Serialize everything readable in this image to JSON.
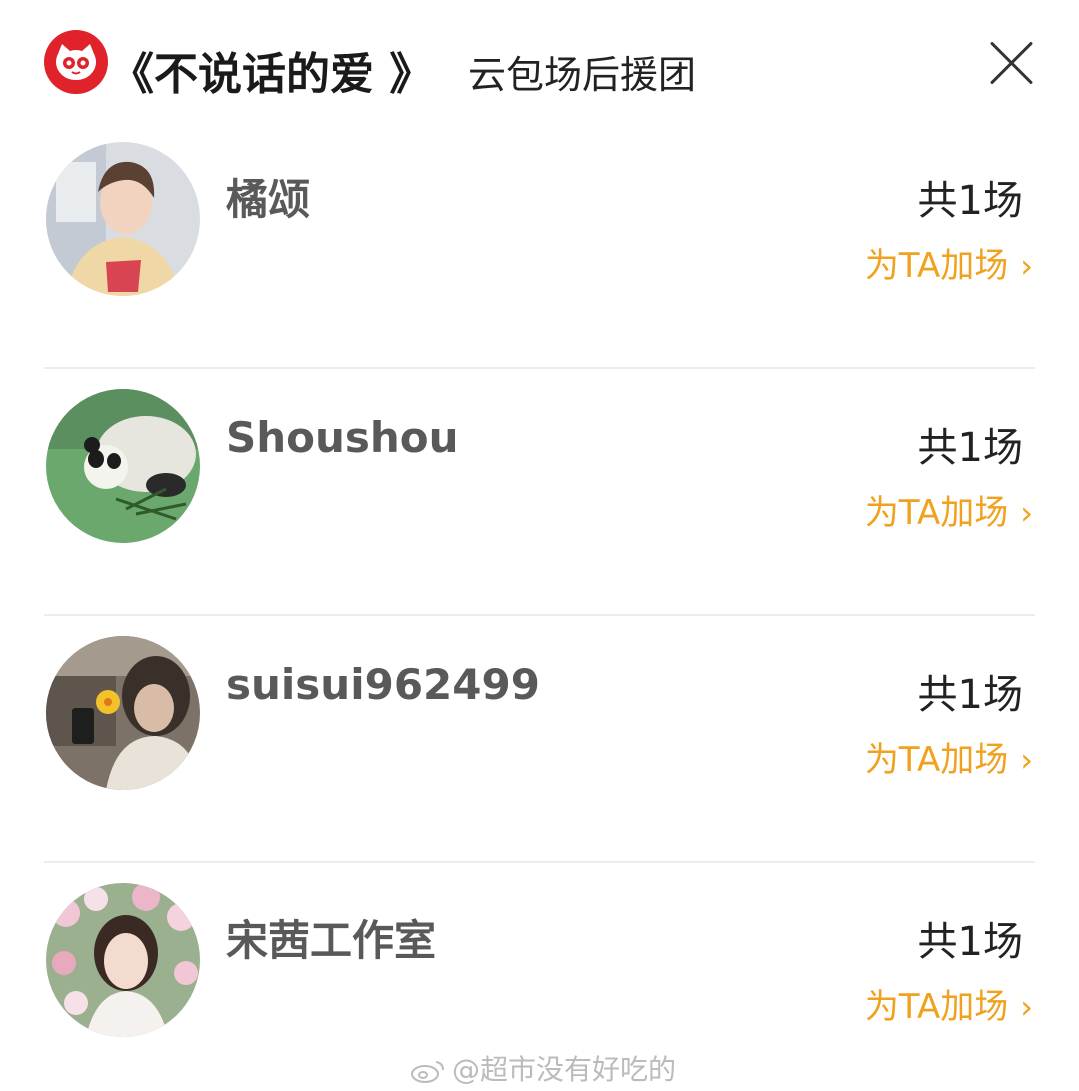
{
  "header": {
    "title": "《不说话的爱 》",
    "subtitle": "云包场后援团",
    "close_icon": "close-icon",
    "logo_icon": "maoyan-cat-logo"
  },
  "supporters": [
    {
      "name": "橘颂",
      "count": "共1场",
      "action": "为TA加场",
      "avatar": "young-man-yellow-hoodie"
    },
    {
      "name": "Shoushou",
      "count": "共1场",
      "action": "为TA加场",
      "avatar": "panda-on-grass"
    },
    {
      "name": "suisui962499",
      "count": "共1场",
      "action": "为TA加场",
      "avatar": "girl-phone-selfie"
    },
    {
      "name": "宋茜工作室",
      "count": "共1场",
      "action": "为TA加场",
      "avatar": "woman-flower-crown"
    }
  ],
  "watermark": {
    "text": "@超市没有好吃的"
  },
  "colors": {
    "accent": "#f0a21e",
    "logo_red": "#e0222b",
    "name_gray": "#595959",
    "divider": "#ececec"
  }
}
